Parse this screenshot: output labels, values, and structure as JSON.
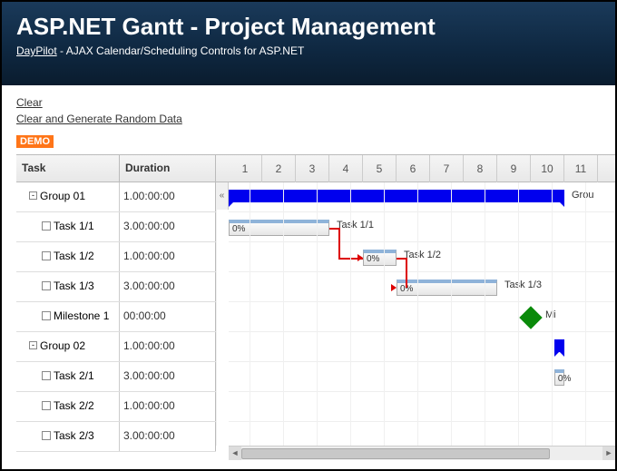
{
  "header": {
    "title": "ASP.NET Gantt - Project Management",
    "brand": "DayPilot",
    "tagline": " - AJAX Calendar/Scheduling Controls for ASP.NET"
  },
  "actions": {
    "clear": "Clear",
    "generate": "Clear and Generate Random Data"
  },
  "badge": "DEMO",
  "columns": {
    "task": "Task",
    "duration": "Duration"
  },
  "timeline": {
    "start": 1,
    "cells": [
      "1",
      "2",
      "3",
      "4",
      "5",
      "6",
      "7",
      "8",
      "9",
      "10",
      "11"
    ]
  },
  "rows": [
    {
      "id": "g1",
      "type": "group",
      "name": "Group 01",
      "duration": "1.00:00:00",
      "indent": 0
    },
    {
      "id": "t11",
      "type": "task",
      "name": "Task 1/1",
      "duration": "3.00:00:00",
      "indent": 1
    },
    {
      "id": "t12",
      "type": "task",
      "name": "Task 1/2",
      "duration": "1.00:00:00",
      "indent": 1
    },
    {
      "id": "t13",
      "type": "task",
      "name": "Task 1/3",
      "duration": "3.00:00:00",
      "indent": 1
    },
    {
      "id": "m1",
      "type": "task",
      "name": "Milestone 1",
      "duration": "00:00:00",
      "indent": 1
    },
    {
      "id": "g2",
      "type": "group",
      "name": "Group 02",
      "duration": "1.00:00:00",
      "indent": 0
    },
    {
      "id": "t21",
      "type": "task",
      "name": "Task 2/1",
      "duration": "3.00:00:00",
      "indent": 1
    },
    {
      "id": "t22",
      "type": "task",
      "name": "Task 2/2",
      "duration": "1.00:00:00",
      "indent": 1
    },
    {
      "id": "t23",
      "type": "task",
      "name": "Task 2/3",
      "duration": "3.00:00:00",
      "indent": 1
    }
  ],
  "chart_data": {
    "type": "gantt",
    "x_unit": "day",
    "x_visible": [
      1,
      11
    ],
    "bars": [
      {
        "row": "g1",
        "kind": "group",
        "start": 1,
        "end": 11,
        "label": "Grou"
      },
      {
        "row": "t11",
        "kind": "task",
        "start": 1,
        "end": 4,
        "progress": "0%",
        "label": "Task 1/1"
      },
      {
        "row": "t12",
        "kind": "task",
        "start": 5,
        "end": 6,
        "progress": "0%",
        "label": "Task 1/2"
      },
      {
        "row": "t13",
        "kind": "task",
        "start": 6,
        "end": 9,
        "progress": "0%",
        "label": "Task 1/3"
      },
      {
        "row": "m1",
        "kind": "milestone",
        "start": 10,
        "label": "Mi"
      },
      {
        "row": "g2",
        "kind": "group",
        "start": 10.7,
        "end": 11,
        "label": ""
      },
      {
        "row": "t21",
        "kind": "task",
        "start": 10.7,
        "end": 11,
        "progress": "0%",
        "label": ""
      }
    ],
    "links": [
      {
        "from": "t11",
        "to": "t12"
      },
      {
        "from": "t12",
        "to": "t13"
      }
    ]
  }
}
